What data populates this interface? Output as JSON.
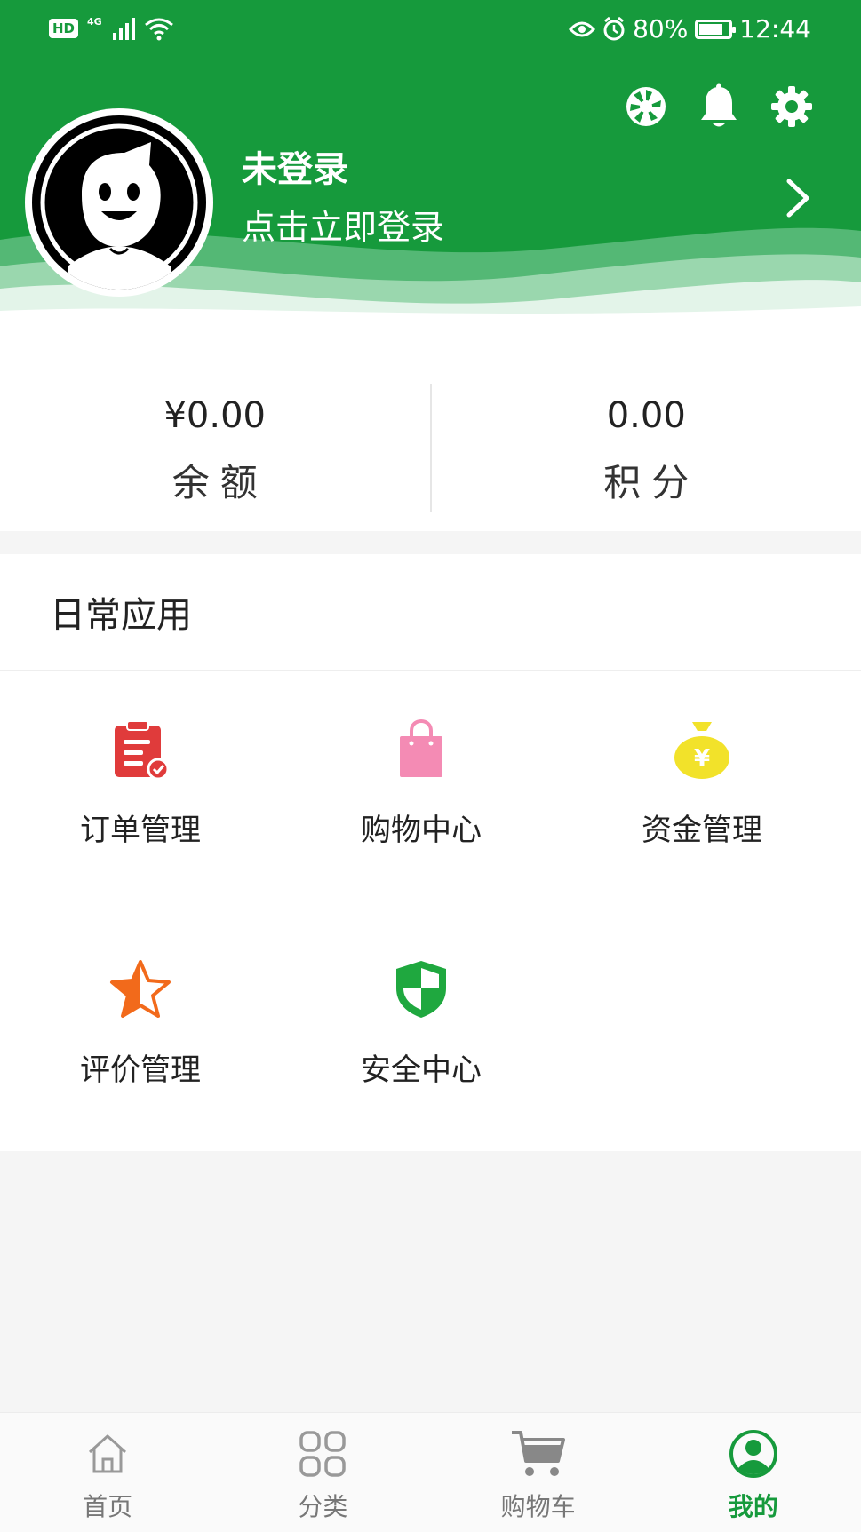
{
  "status_bar": {
    "hd": "HD",
    "network": "4G",
    "battery_percent": "80%",
    "battery_level": 0.8,
    "time": "12:44"
  },
  "header": {
    "title": "未登录",
    "subtitle": "点击立即登录"
  },
  "balance": {
    "amount": "¥0.00",
    "amount_label": "余额",
    "points": "0.00",
    "points_label": "积分"
  },
  "apps": {
    "title": "日常应用",
    "items": [
      {
        "label": "订单管理",
        "icon": "order-icon"
      },
      {
        "label": "购物中心",
        "icon": "shopping-bag-icon"
      },
      {
        "label": "资金管理",
        "icon": "money-bag-icon"
      },
      {
        "label": "评价管理",
        "icon": "star-icon"
      },
      {
        "label": "安全中心",
        "icon": "shield-icon"
      }
    ]
  },
  "nav": {
    "items": [
      {
        "label": "首页",
        "icon": "home-icon"
      },
      {
        "label": "分类",
        "icon": "category-icon"
      },
      {
        "label": "购物车",
        "icon": "cart-icon"
      },
      {
        "label": "我的",
        "icon": "profile-icon"
      }
    ],
    "active_index": 3
  },
  "colors": {
    "brand": "#169a3c",
    "order": "#e03b3b",
    "bag": "#f48bb4",
    "money": "#f2e22a",
    "star": "#f26a1b",
    "shield": "#1fa83f"
  }
}
